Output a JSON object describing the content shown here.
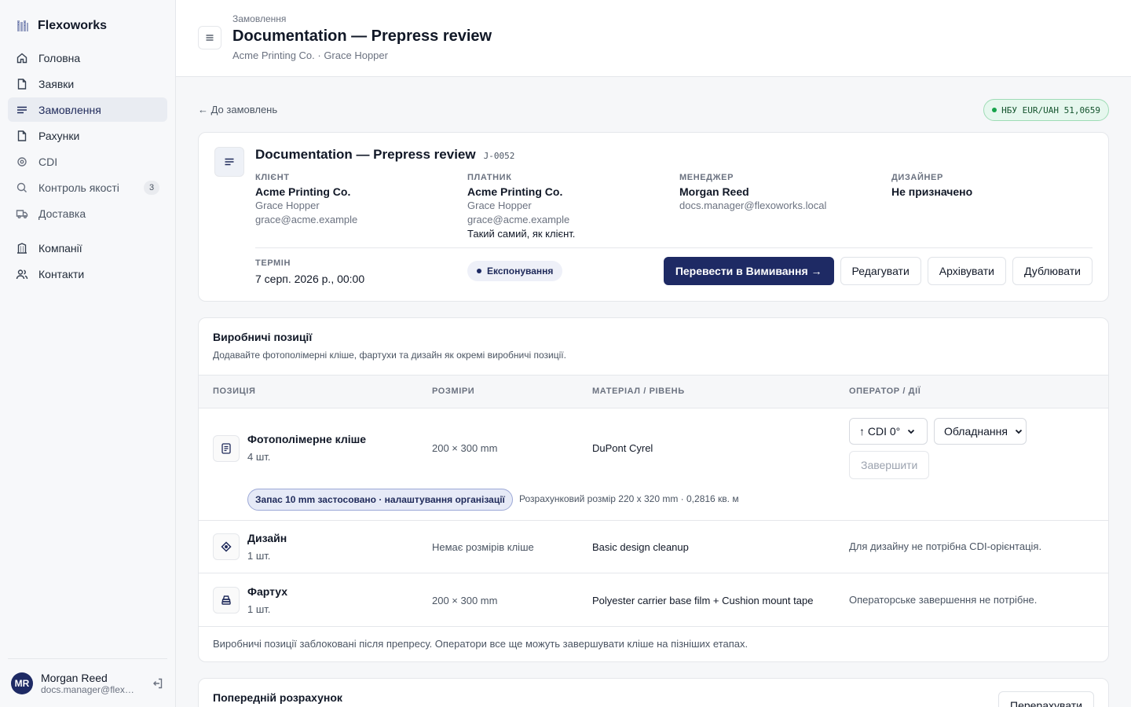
{
  "brand": {
    "name": "Flexoworks"
  },
  "sidebar": {
    "items": [
      {
        "label": "Головна",
        "icon": "home-icon"
      },
      {
        "label": "Заявки",
        "icon": "file-icon"
      },
      {
        "label": "Замовлення",
        "icon": "list-icon",
        "active": true
      },
      {
        "label": "Рахунки",
        "icon": "file-icon"
      },
      {
        "label": "CDI",
        "icon": "target-icon"
      },
      {
        "label": "Контроль якості",
        "icon": "search-icon",
        "badge": "3"
      },
      {
        "label": "Доставка",
        "icon": "truck-icon"
      }
    ],
    "items2": [
      {
        "label": "Компанії",
        "icon": "building-icon"
      },
      {
        "label": "Контакти",
        "icon": "users-icon"
      }
    ],
    "user": {
      "initials": "MR",
      "name": "Morgan Reed",
      "email": "docs.manager@flexoworks.local"
    }
  },
  "header": {
    "crumb": "Замовлення",
    "title": "Documentation — Prepress review",
    "subtitle": "Acme Printing Co. · Grace Hopper"
  },
  "main": {
    "back_label": "← До замовлень",
    "rate": "НБУ EUR/UAH 51,0659"
  },
  "order": {
    "title": "Documentation — Prepress review",
    "code": "J-0052",
    "client": {
      "label": "КЛІЄНТ",
      "name": "Acme Printing Co.",
      "contact": "Grace Hopper",
      "email": "grace@acme.example"
    },
    "payer": {
      "label": "ПЛАТНИК",
      "name": "Acme Printing Co.",
      "contact": "Grace Hopper",
      "email": "grace@acme.example",
      "note": "Такий самий, як клієнт."
    },
    "manager": {
      "label": "МЕНЕДЖЕР",
      "name": "Morgan Reed",
      "email": "docs.manager@flexoworks.local"
    },
    "designer": {
      "label": "ДИЗАЙНЕР",
      "name": "Не призначено"
    },
    "term_label": "ТЕРМІН",
    "term_value": "7 серп. 2026 р., 00:00",
    "stage": "Експонування",
    "actions": {
      "primary": "Перевести в Вимивання →",
      "edit": "Редагувати",
      "archive": "Архівувати",
      "duplicate": "Дублювати"
    }
  },
  "production": {
    "title": "Виробничі позиції",
    "subtitle": "Додавайте фотополімерні кліше, фартухи та дизайн як окремі виробничі позиції.",
    "columns": [
      "ПОЗИЦІЯ",
      "РОЗМІРИ",
      "МАТЕРІАЛ / РІВЕНЬ",
      "ОПЕРАТОР / ДІЇ"
    ],
    "rows": [
      {
        "name": "Фотополімерне кліше",
        "qty": "4 шт.",
        "size": "200 × 300 mm",
        "material": "DuPont Cyrel",
        "icon": "document-icon",
        "cdi_select": "↑ CDI 0°",
        "equipment_select": "Обладнання",
        "finish_label": "Завершити",
        "margin_pill": "Запас 10 mm застосовано · налаштування організації",
        "calc_note": "Розрахунковий розмір 220 x 320 mm · 0,2816 кв. м"
      },
      {
        "name": "Дизайн",
        "qty": "1 шт.",
        "size": "Немає розмірів кліше",
        "material": "Basic design cleanup",
        "icon": "diamond-icon",
        "operator_note": "Для дизайну не потрібна CDI-орієнтація."
      },
      {
        "name": "Фартух",
        "qty": "1 шт.",
        "size": "200 × 300 mm",
        "material": "Polyester carrier base film + Cushion mount tape",
        "icon": "stack-icon",
        "operator_note": "Операторське завершення не потрібне."
      }
    ],
    "footer": "Виробничі позиції заблоковані після препресу. Оператори все ще можуть завершувати кліше на пізніших етапах."
  },
  "estimate": {
    "title": "Попередній розрахунок",
    "recalc_label": "Перерахувати"
  }
}
